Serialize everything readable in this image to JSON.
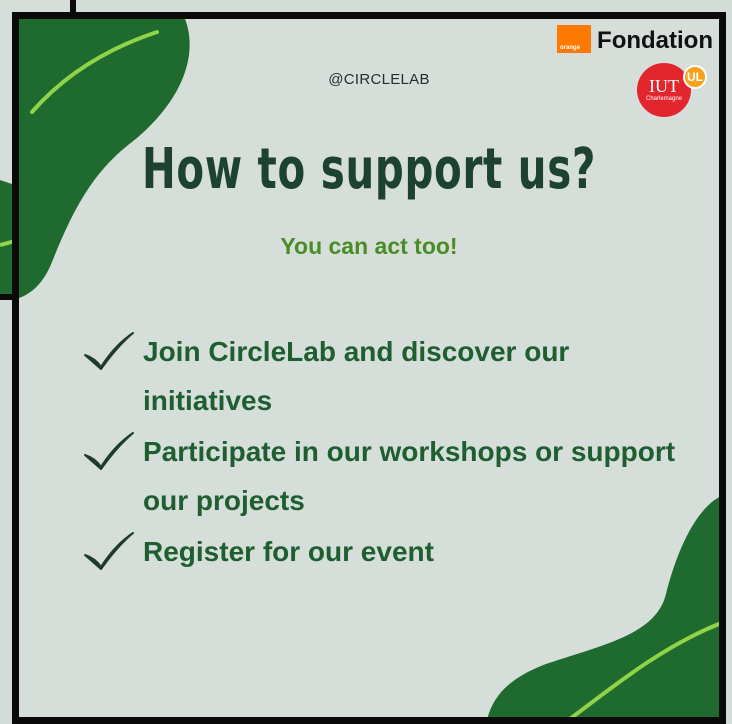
{
  "header": {
    "handle": "@CIRCLELAB",
    "fondation_label": "Fondation",
    "orange_label": "orange",
    "iut_label": "IUT",
    "iut_sub": "Charlemagne",
    "ul_label": "UL"
  },
  "main": {
    "title": "How to support us?",
    "subtitle": "You can act too!",
    "items": [
      {
        "text": "Join CircleLab and discover our initiatives"
      },
      {
        "text": "Participate in our workshops or support our projects"
      },
      {
        "text": "Register for our event"
      }
    ]
  },
  "colors": {
    "background": "#d6ded9",
    "deco_green": "#1f6a2f",
    "accent_lime": "#8fd448",
    "title": "#1d4133",
    "subtitle": "#4a8c25",
    "list_text": "#1e5e30"
  }
}
